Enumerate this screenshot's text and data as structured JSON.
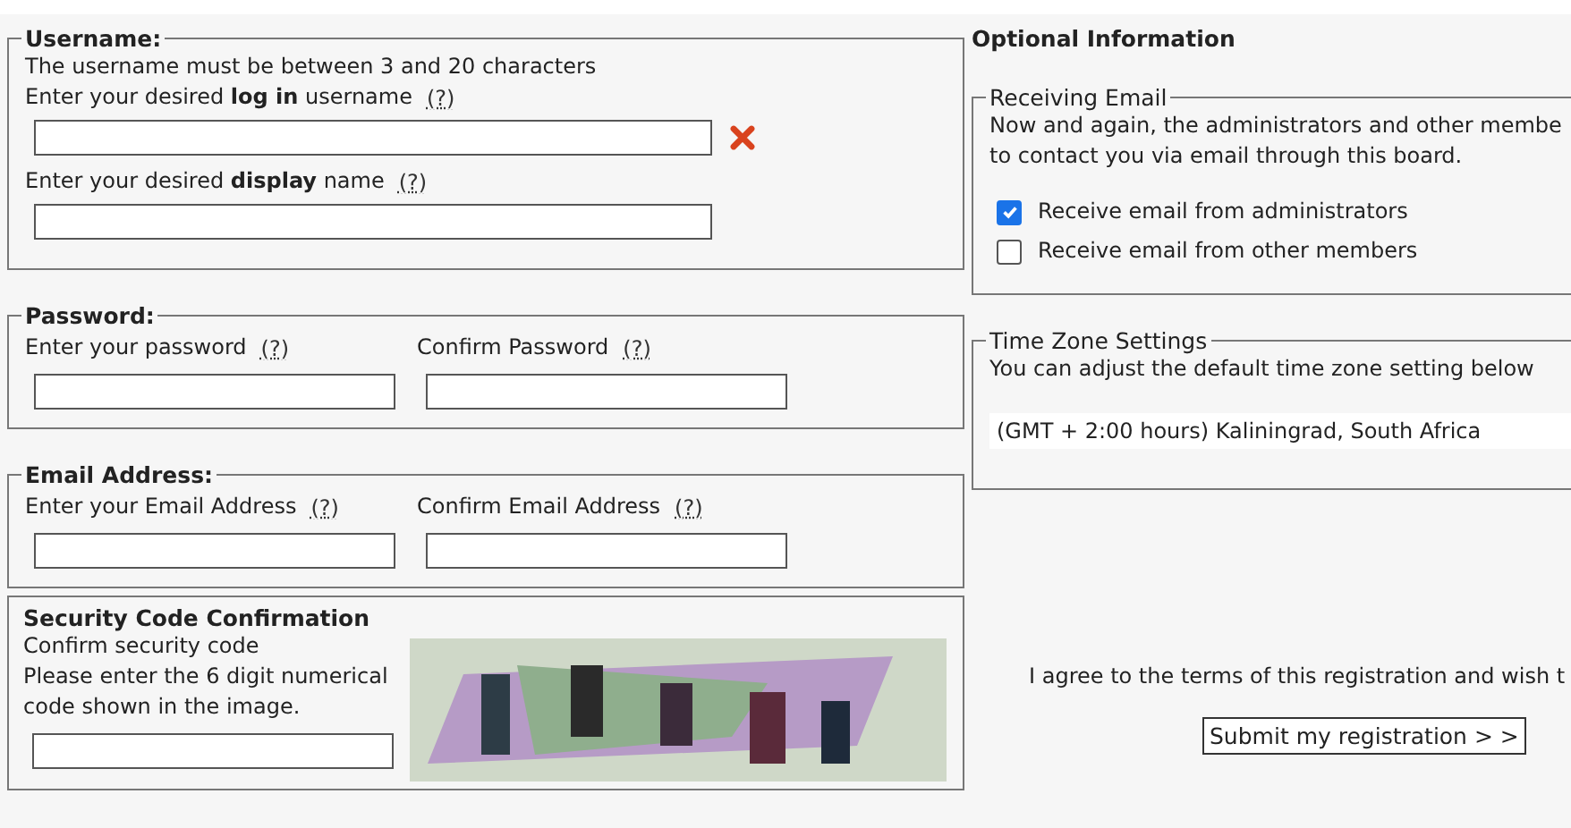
{
  "username": {
    "legend": "Username:",
    "hint": "The username must be between 3 and 20 characters",
    "fields": [
      {
        "label": "Enter your desired **log in** username",
        "help": "(?)",
        "error": true
      },
      {
        "label": "Enter your desired **display** name",
        "help": "(?)",
        "error": false
      }
    ]
  },
  "password": {
    "legend": "Password:",
    "fields": [
      {
        "label": "Enter your password",
        "help": "(?)"
      },
      {
        "label": "Confirm Password",
        "help": "(?)"
      }
    ]
  },
  "email": {
    "legend": "Email Address:",
    "fields": [
      {
        "label": "Enter your Email Address",
        "help": "(?)"
      },
      {
        "label": "Confirm Email Address",
        "help": "(?)"
      }
    ]
  },
  "security": {
    "title": "Security Code Confirmation",
    "lines": [
      "Confirm security code",
      "Please enter the 6 digit numerical code shown in the image."
    ]
  },
  "optional": {
    "title": "Optional Information",
    "receiving": {
      "legend": "Receiving Email",
      "text": "Now and again, the administrators and other membe to contact you via email through this board.",
      "options": [
        {
          "label": "Receive email from administrators",
          "checked": true
        },
        {
          "label": "Receive email from other members",
          "checked": false
        }
      ]
    },
    "timezone": {
      "legend": "Time Zone Settings",
      "text": "You can adjust the default time zone setting below",
      "value": "(GMT + 2:00 hours) Kaliningrad, South Africa"
    },
    "agree": "I agree to the terms of this registration and wish t",
    "submit": "Submit my registration > >"
  }
}
